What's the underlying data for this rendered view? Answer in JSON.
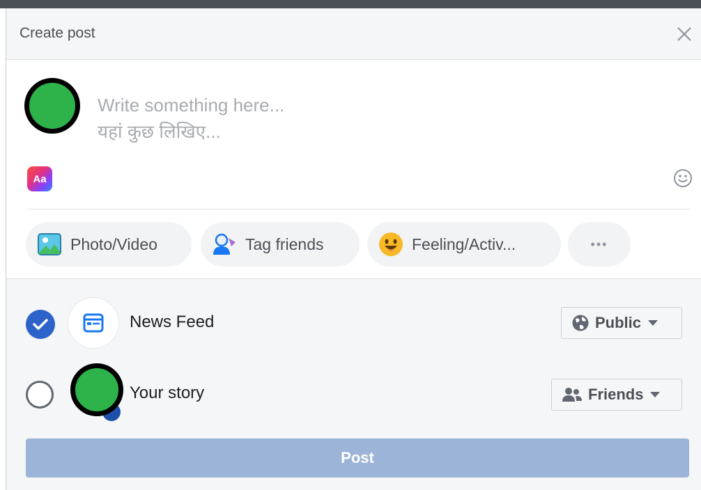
{
  "header": {
    "title": "Create post"
  },
  "composer": {
    "placeholder": "Write something here...\nयहां कुछ लिखिए..."
  },
  "text_style_button": {
    "label": "Aa"
  },
  "actions": [
    {
      "label": "Photo/Video",
      "icon": "photo-icon"
    },
    {
      "label": "Tag friends",
      "icon": "tag-friends-icon"
    },
    {
      "label": "Feeling/Activ...",
      "icon": "feeling-emoji-icon"
    },
    {
      "label": "•••",
      "icon": "more-icon"
    }
  ],
  "destinations": {
    "news_feed": {
      "label": "News Feed",
      "checked": true,
      "audience": "Public"
    },
    "your_story": {
      "label": "Your story",
      "checked": false,
      "audience": "Friends"
    }
  },
  "post_button": {
    "label": "Post"
  },
  "colors": {
    "accent": "#2d63c8",
    "post_button_disabled": "#9cb4d8",
    "avatar": "#2db34a"
  }
}
